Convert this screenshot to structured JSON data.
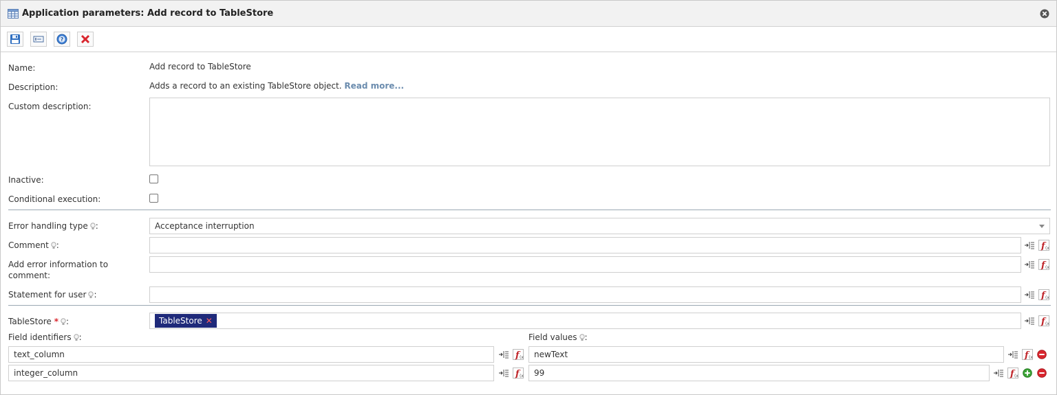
{
  "window": {
    "title": "Application parameters: Add record to TableStore",
    "icon": "table-icon",
    "close_icon": "close-circle-icon"
  },
  "toolbar": {
    "buttons": [
      {
        "name": "save-button",
        "icon": "floppy-icon"
      },
      {
        "name": "input-field-button",
        "icon": "input-field-icon"
      },
      {
        "name": "help-button",
        "icon": "help-icon"
      },
      {
        "name": "cancel-button",
        "icon": "red-x-icon"
      }
    ]
  },
  "form": {
    "name_label": "Name:",
    "name_value": "Add record to TableStore",
    "description_label": "Description:",
    "description_value": "Adds a record to an existing TableStore object.",
    "read_more": "Read more...",
    "custom_description_label": "Custom description:",
    "custom_description_value": "",
    "inactive_label": "Inactive:",
    "inactive_checked": false,
    "conditional_label": "Conditional execution:",
    "conditional_checked": false,
    "error_handling_label": "Error handling type",
    "error_handling_value": "Acceptance interruption",
    "comment_label": "Comment",
    "comment_value": "",
    "add_error_label_1": "Add error information to",
    "add_error_label_2": "comment:",
    "add_error_value": "",
    "statement_label": "Statement for user",
    "statement_value": "",
    "tablestore_label": "TableStore",
    "tablestore_required": "*",
    "tablestore_tag": "TableStore",
    "tag_remove": "✕",
    "colon": ":"
  },
  "fields": {
    "identifiers_label": "Field identifiers",
    "values_label": "Field values",
    "rows": [
      {
        "identifier": "text_column",
        "value": "newText"
      },
      {
        "identifier": "integer_column",
        "value": "99"
      }
    ]
  },
  "colors": {
    "accent": "#1f2a7a",
    "link": "#6b8cae",
    "required": "#d9262e",
    "remove": "#d9262e",
    "add": "#3aa335"
  }
}
